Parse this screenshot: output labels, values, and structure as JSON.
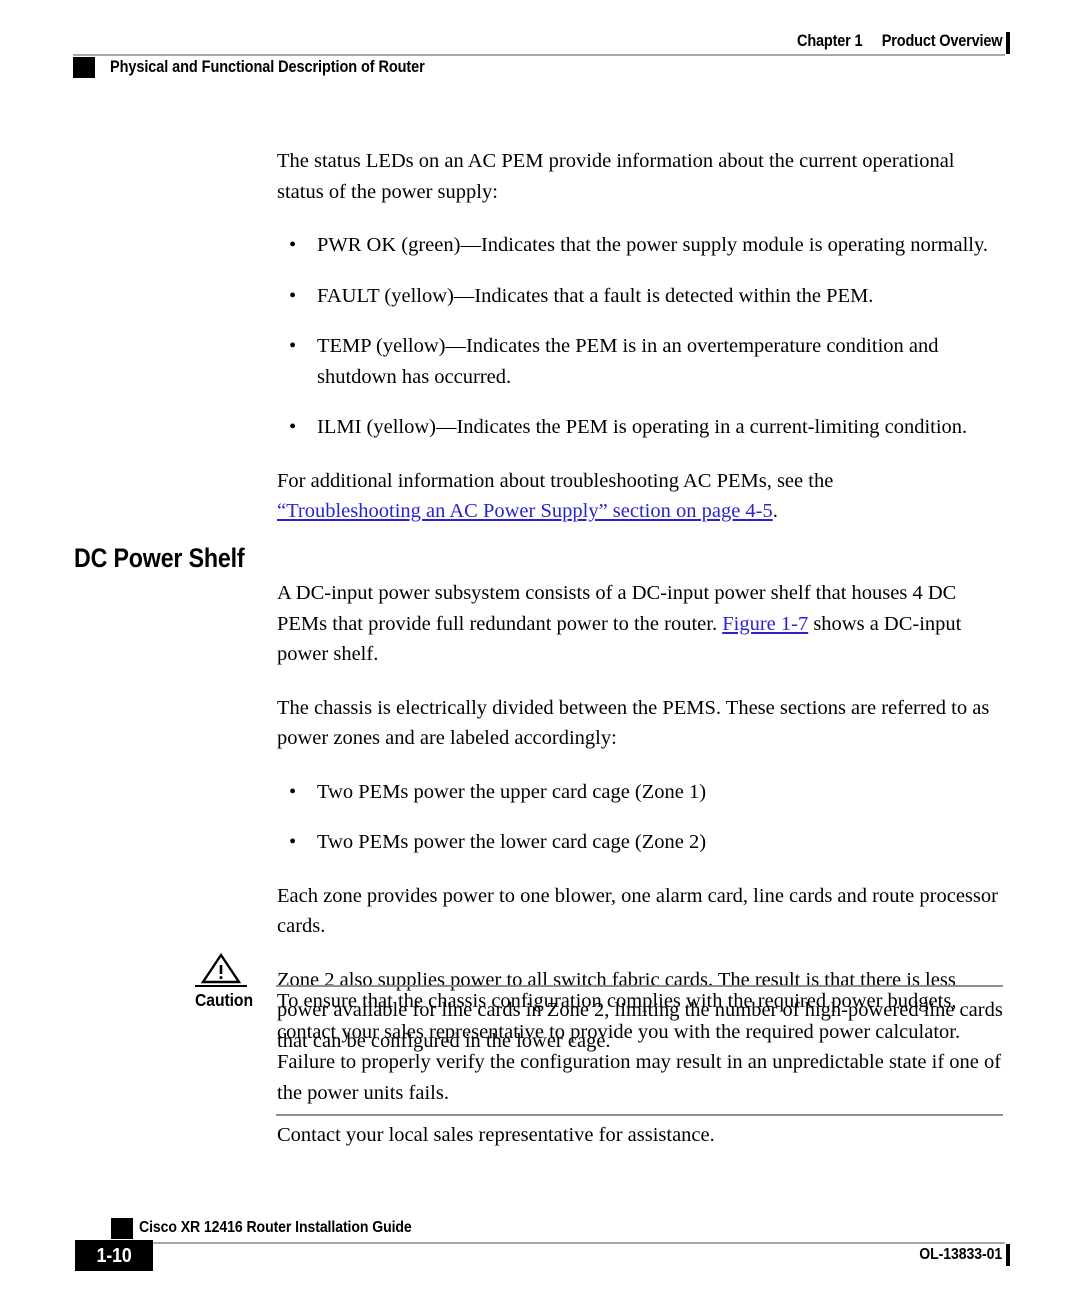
{
  "header": {
    "chapter_label": "Chapter 1",
    "chapter_title": "Product Overview",
    "section_title": "Physical and Functional Description of Router"
  },
  "body": {
    "intro_paragraph": "The status LEDs on an AC PEM provide information about the current operational status of the power supply:",
    "led_bullets": [
      "PWR OK (green)—Indicates that the power supply module is operating normally.",
      "FAULT (yellow)—Indicates that a fault is detected within the PEM.",
      "TEMP (yellow)—Indicates the PEM is in an overtemperature condition and shutdown has occurred.",
      "ILMI (yellow)—Indicates the PEM is operating in a current-limiting condition."
    ],
    "troubleshooting_lead": "For additional information about troubleshooting AC PEMs, see the",
    "troubleshooting_link": "“Troubleshooting an AC Power Supply” section on page 4-5",
    "troubleshooting_period": "."
  },
  "section": {
    "heading": "DC Power Shelf",
    "paragraph_1a": "A DC-input power subsystem consists of a DC-input power shelf that houses 4 DC PEMs that provide full redundant power to the router. ",
    "paragraph_1_link": "Figure 1-7",
    "paragraph_1b": " shows a DC-input power shelf.",
    "paragraph_2": "The chassis is electrically divided between the PEMS. These sections are referred to as power zones and are labeled accordingly:",
    "zone_bullets": [
      "Two PEMs power the upper card cage (Zone 1)",
      "Two PEMs power the lower card cage (Zone 2)"
    ],
    "paragraph_3": "Each zone provides power to one blower, one alarm card, line cards and route processor cards.",
    "paragraph_4": "Zone 2 also supplies power to all switch fabric cards. The result is that there is less power available for line cards in Zone 2, limiting the number of high-powered line cards that can be configured in the lower cage."
  },
  "caution": {
    "label": "Caution",
    "text": "To ensure that the chassis configuration complies with the required power budgets, contact your sales representative to provide you with the required power calculator. Failure to properly verify the configuration may result in an unpredictable state if one of the power units fails."
  },
  "after_caution": "Contact your local sales representative for assistance.",
  "footer": {
    "page_number": "1-10",
    "guide_title": "Cisco XR 12416 Router Installation Guide",
    "doc_number": "OL-13833-01"
  },
  "bullet_glyph": "•",
  "colors": {
    "link": "#2a23cc",
    "rule_gray": "#a8a8a8",
    "marker_black": "#000000"
  }
}
